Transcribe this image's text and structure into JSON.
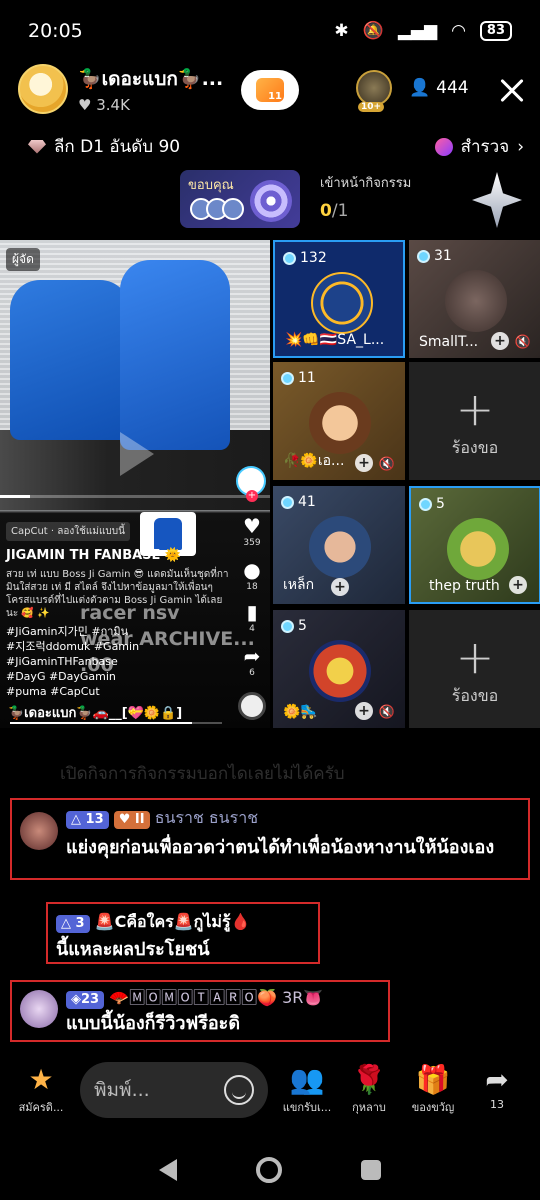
{
  "status": {
    "time": "20:05",
    "battery": "83"
  },
  "host": {
    "name": "🦆เดอะแบก🦆...",
    "likes": "3.4K",
    "follow_badge": "11"
  },
  "top_fan_badge": "10+",
  "viewers": "444",
  "league": "ลีก D1 อันดับ 90",
  "explore": "สำรวจ",
  "activity_banner": {
    "label": "ขอบคุณ",
    "title": "เข้าหน้ากิจกรรม",
    "progress_done": "0",
    "progress_total": "/1"
  },
  "video": {
    "owner_tag": "ผู้จัด",
    "capcut": "CapCut · ลองใช้แม่แบบนี้",
    "title": "JIGAMIN TH FANBASE 🌞",
    "desc": "สวย เท่ แบบ Boss Ji Gamin 😎 แดดมันเห็นชุดที่กามินใส่สวย เท่ มี สไตล์ จึงไปหาข้อมูลมาให้เพื่อนๆ โครสแบรด์ที่ไปแต่งตัวตาม Boss Ji Gamin ได้เลยนะ 🥰 ✨",
    "ghost_text": "racer nsv\nwear ARCHIVE...\n.00",
    "tags": "#JiGamin지가민 #กามิน\n#지조럭ddomuk #Gamin\n#JiGaminTHFanbase\n#DayG #DayGamin\n#puma #CapCut",
    "footer": "🦆เดอะแบก🦆🚗__[💝🌼🔒]",
    "likes": "359",
    "comments": "18",
    "saves": "4",
    "shares": "6"
  },
  "tiles": [
    {
      "count": "132",
      "name": "💥👊🇹🇭SA_L..."
    },
    {
      "count": "31",
      "name": "SmallT..."
    },
    {
      "count": "11",
      "name": "🥀🌼เอ..."
    },
    {
      "count": "41",
      "name": "เหล็ก"
    },
    {
      "count": "5",
      "name": "thep truth"
    },
    {
      "count": "5",
      "name": "🌼🛼"
    }
  ],
  "empty_tile_label": "ร้องขอ",
  "faded_comment": "เปิดกิจการกิจกรรมบอกไดเลยไม่ได้ครับ",
  "comments": [
    {
      "level": "13",
      "fan_level": "II",
      "name": "ธนราช ธนราช",
      "text": "แย่งคุยก่อนเพื่ออวดว่าตนได้ทำเพื่อน้องหางานให้น้องเอง"
    },
    {
      "level": "3",
      "name": "🚨Cคือใคร🚨กูไม่รู้🩸",
      "text": "นี้แหละผลประโยชน์"
    },
    {
      "level": "23",
      "name": "🪭🄼🄾🄼🄾🅃🄰🅁🄾🍑 3R👅",
      "text": "แบบนี้น้องก็รีวิวฟรีอะดิ"
    }
  ],
  "bottom_bar": {
    "subscribe": "สมัครดิ...",
    "input_placeholder": "พิมพ์...",
    "guests": "แขกรับเ...",
    "rose": "กุหลาบ",
    "gift": "ของขวัญ",
    "share_count": "13"
  },
  "colors": {
    "accent": "#2a9df4",
    "highlight_box": "#d42a2a",
    "level_badge": "#5364d6"
  }
}
